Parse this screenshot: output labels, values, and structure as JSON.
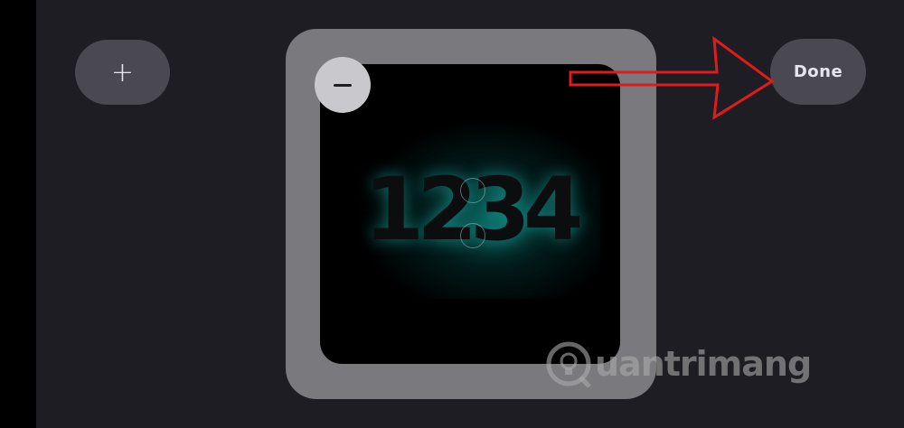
{
  "toolbar": {
    "add_label": "+",
    "done_label": "Done"
  },
  "widget": {
    "clock_text": "1234",
    "remove_label": "−"
  },
  "watermark": {
    "text": "uantrimang"
  },
  "annotation": {
    "arrow_color": "#e01b1b"
  },
  "icons": [
    "plus-icon",
    "minus-icon",
    "lightbulb-logo-icon",
    "arrow-annotation"
  ]
}
